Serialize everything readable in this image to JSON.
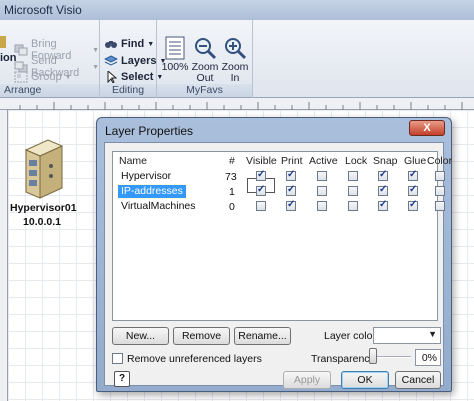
{
  "app": {
    "title": "Microsoft Visio"
  },
  "ribbon": {
    "arrange": {
      "label": "Arrange",
      "partial_label": "ion",
      "bring_forward": "Bring Forward",
      "send_backward": "Send Backward",
      "group": "Group"
    },
    "editing": {
      "label": "Editing",
      "find": "Find",
      "layers": "Layers",
      "select": "Select"
    },
    "myfavs": {
      "label": "MyFavs",
      "zoom100": "100%",
      "zoom_out_1": "Zoom",
      "zoom_out_2": "Out",
      "zoom_in_1": "Zoom",
      "zoom_in_2": "In"
    }
  },
  "canvas": {
    "shape": {
      "name": "Hypervisor01",
      "ip": "10.0.0.1"
    }
  },
  "dialog": {
    "title": "Layer Properties",
    "close_label": "X",
    "columns": [
      "Name",
      "#",
      "Visible",
      "Print",
      "Active",
      "Lock",
      "Snap",
      "Glue",
      "Color"
    ],
    "layers": [
      {
        "name": "Hypervisor",
        "count": "73",
        "visible": true,
        "print": true,
        "active": false,
        "lock": false,
        "snap": true,
        "glue": true,
        "color": false
      },
      {
        "name": "IP-addresses",
        "count": "1",
        "visible": true,
        "print": true,
        "active": false,
        "lock": false,
        "snap": true,
        "glue": true,
        "color": false
      },
      {
        "name": "VirtualMachines",
        "count": "0",
        "visible": false,
        "print": true,
        "active": false,
        "lock": false,
        "snap": true,
        "glue": true,
        "color": false
      }
    ],
    "new_button": "New...",
    "remove_button": "Remove",
    "rename_button": "Rename...",
    "layer_color_label": "Layer color:",
    "remove_unreferenced_label": "Remove unreferenced layers",
    "transparency_label": "Transparency:",
    "transparency_value": "0%",
    "help_label": "?",
    "apply_button": "Apply",
    "ok_button": "OK",
    "cancel_button": "Cancel"
  }
}
